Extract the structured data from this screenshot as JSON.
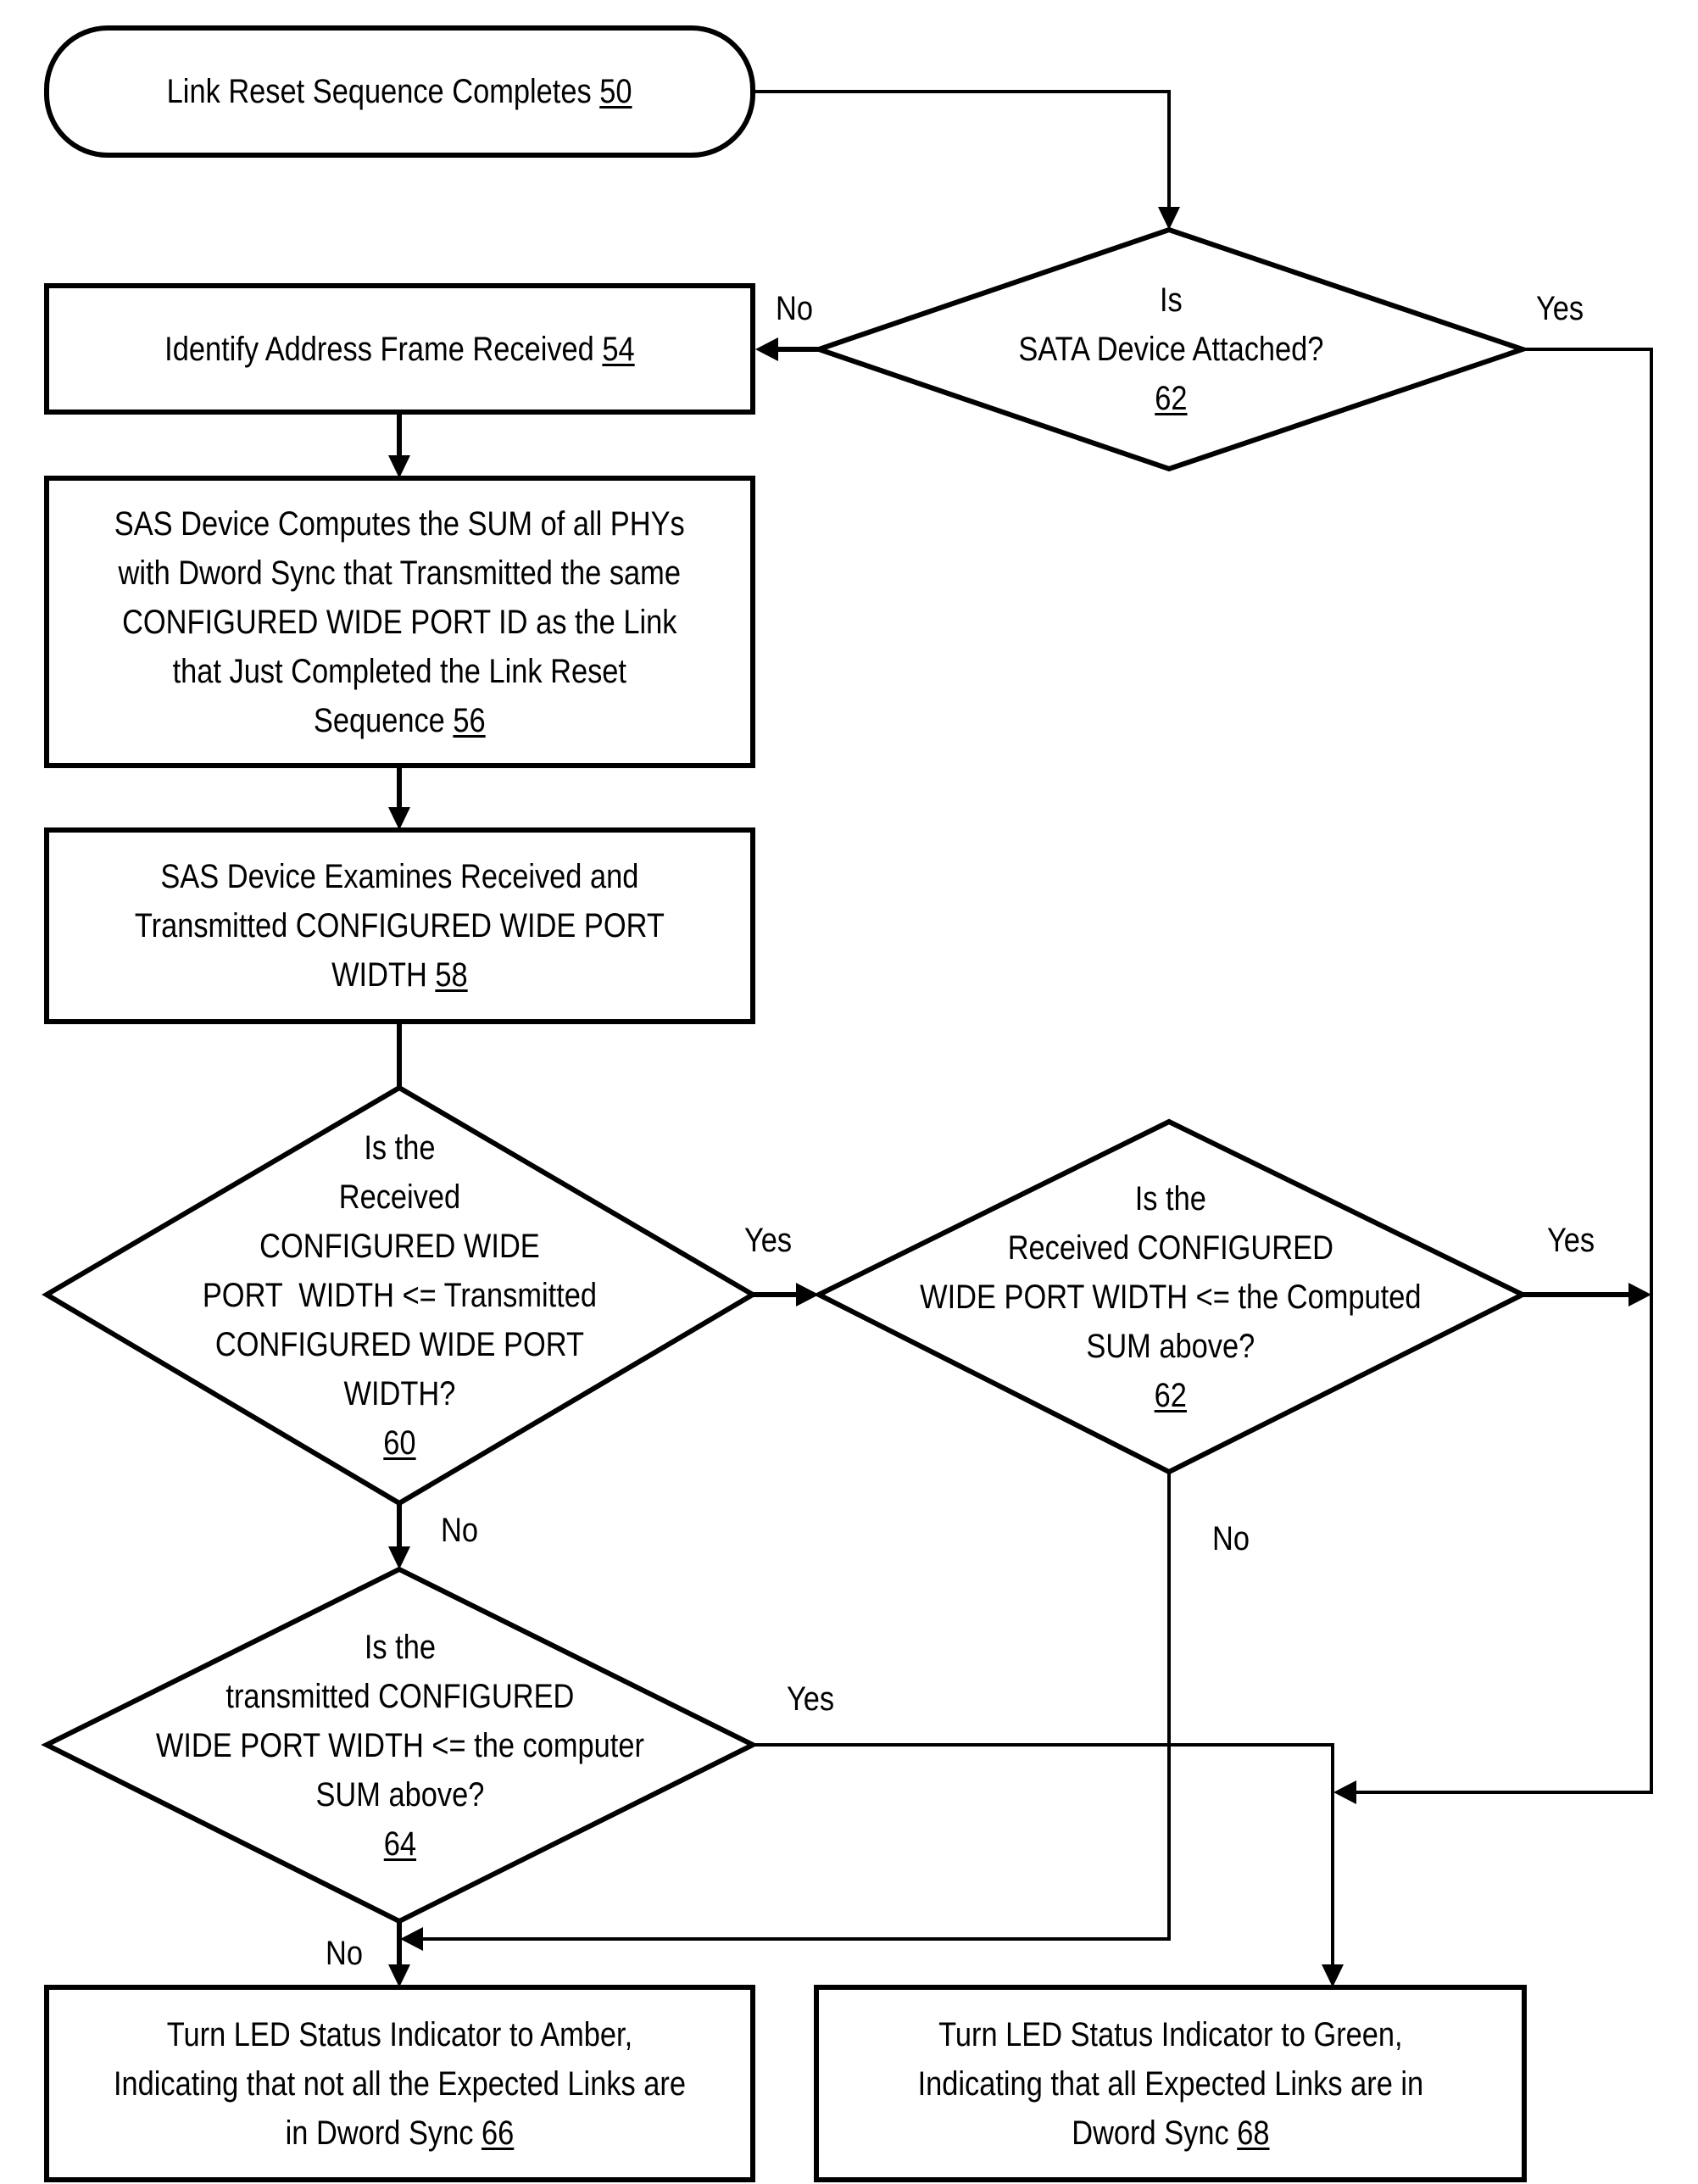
{
  "nodes": {
    "n50": {
      "type": "terminal",
      "lines": [
        "Link Reset Sequence Completes"
      ],
      "ref": "50"
    },
    "n54": {
      "type": "process",
      "lines": [
        "Identify Address Frame Received"
      ],
      "ref": "54"
    },
    "n56": {
      "type": "process",
      "lines": [
        "SAS Device Computes the SUM of all PHYs",
        "with Dword Sync that Transmitted the same",
        "CONFIGURED WIDE PORT ID as the Link",
        "that Just Completed the Link Reset",
        "Sequence"
      ],
      "ref": "56"
    },
    "n58": {
      "type": "process",
      "lines": [
        "SAS Device Examines Received and",
        "Transmitted CONFIGURED WIDE PORT",
        "WIDTH"
      ],
      "ref": "58"
    },
    "n62a": {
      "type": "decision",
      "lines": [
        "Is",
        "SATA Device Attached?"
      ],
      "ref": "62"
    },
    "n60": {
      "type": "decision",
      "lines": [
        "Is the",
        "Received",
        "CONFIGURED WIDE",
        "PORT  WIDTH <= Transmitted",
        "CONFIGURED WIDE PORT",
        "WIDTH?"
      ],
      "ref": "60"
    },
    "n62b": {
      "type": "decision",
      "lines": [
        "Is the",
        "Received CONFIGURED",
        "WIDE PORT WIDTH <= the Computed",
        "SUM above?"
      ],
      "ref": "62"
    },
    "n64": {
      "type": "decision",
      "lines": [
        "Is the",
        "transmitted CONFIGURED",
        "WIDE PORT WIDTH <= the computer",
        "SUM above?"
      ],
      "ref": "64"
    },
    "n66": {
      "type": "process",
      "lines": [
        "Turn LED Status Indicator to Amber,",
        "Indicating that not all the Expected Links are",
        "in Dword Sync"
      ],
      "ref": "66"
    },
    "n68": {
      "type": "process",
      "lines": [
        "Turn LED Status Indicator to Green,",
        "Indicating that all Expected Links are in",
        "Dword Sync"
      ],
      "ref": "68"
    }
  },
  "edge_labels": {
    "sata_no": "No",
    "sata_yes": "Yes",
    "n60_yes": "Yes",
    "n60_no": "No",
    "n62b_yes": "Yes",
    "n62b_no": "No",
    "n64_yes": "Yes",
    "n64_no": "No"
  },
  "colors": {
    "stroke": "#000000",
    "background": "#ffffff"
  }
}
